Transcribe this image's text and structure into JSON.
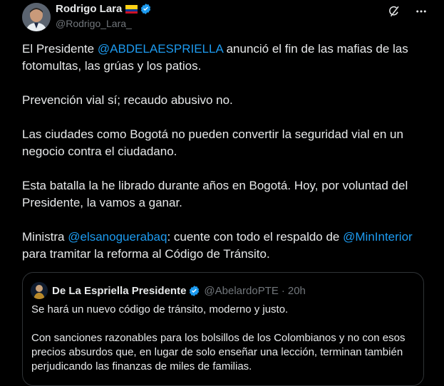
{
  "author": {
    "display_name": "Rodrigo Lara",
    "handle": "@Rodrigo_Lara_",
    "flag_icon": "colombia-flag-icon",
    "verified_color": "#1d9bf0"
  },
  "post": {
    "p1_prefix": "El Presidente ",
    "p1_mention": "@ABDELAESPRIELLA",
    "p1_suffix": " anunció el fin de las mafias de las fotomultas, las grúas y los patios.",
    "p2": "Prevención vial sí; recaudo abusivo no.",
    "p3": "Las ciudades como Bogotá no pueden convertir la seguridad vial en un negocio contra el ciudadano.",
    "p4": "Esta batalla la he librado durante años en Bogotá. Hoy, por voluntad del Presidente, la vamos a ganar.",
    "p5_prefix": "Ministra ",
    "p5_mention1": "@elsanoguerabaq",
    "p5_middle": ": cuente con todo el respaldo de ",
    "p5_mention2": "@MinInterior",
    "p5_suffix": " para tramitar la reforma al Código de Tránsito."
  },
  "quote": {
    "display_name": "De La Espriella Presidente",
    "handle": "@AbelardoPTE",
    "separator": "·",
    "time": "20h",
    "line1": "Se hará un nuevo código de tránsito, moderno y justo.",
    "line2": "Con sanciones razonables para los bolsillos de los Colombianos y no con esos precios absurdos que, en lugar de solo enseñar una lección, terminan también perjudicando las finanzas de miles de familias."
  },
  "colors": {
    "background": "#000000",
    "text": "#e7e9ea",
    "secondary": "#71767b",
    "link": "#1d9bf0",
    "border": "#2f3336"
  }
}
